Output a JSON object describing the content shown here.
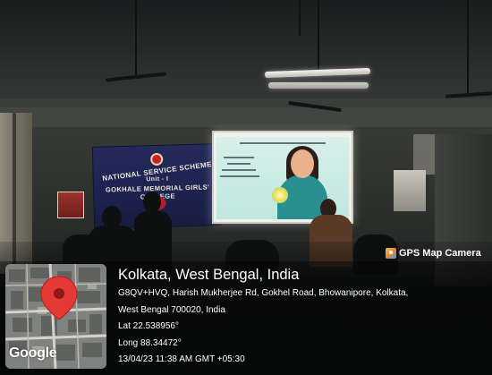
{
  "banner": {
    "arc_text": "NATIONAL SERVICE SCHEME",
    "unit": "Unit - I",
    "college": "GOKHALE MEMORIAL GIRLS' COLLEGE"
  },
  "gps_badge": {
    "label": "GPS Map Camera"
  },
  "map": {
    "google_logo": "Google"
  },
  "location": {
    "title": "Kolkata, West Bengal, India",
    "address_line1": "G8QV+HVQ, Harish Mukherjee Rd, Gokhel Road, Bhowanipore, Kolkata,",
    "address_line2": "West Bengal 700020, India",
    "latitude": "Lat 22.538956°",
    "longitude": "Long 88.34472°",
    "datetime": "13/04/23 11:38 AM GMT +05:30"
  },
  "colors": {
    "pin": "#e53935",
    "banner": "#1f2452",
    "slide_bg": "#c8ebe3"
  }
}
